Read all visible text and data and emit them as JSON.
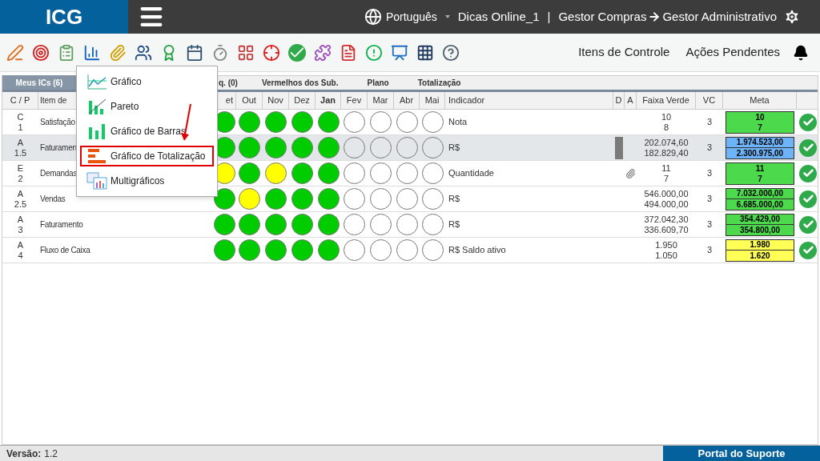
{
  "header": {
    "logo": "ICG",
    "language": "Português",
    "company": "Dicas Online_1",
    "separator": "|",
    "from_role": "Gestor Compras",
    "to_role": "Gestor Administrativo"
  },
  "toolbar": {
    "links": [
      "Itens de Controle",
      "Ações Pendentes"
    ]
  },
  "menu": {
    "items": [
      {
        "label": "Gráfico",
        "kind": "line",
        "selected": false
      },
      {
        "label": "Pareto",
        "kind": "pareto",
        "selected": false
      },
      {
        "label": "Gráfico de Barras",
        "kind": "bars",
        "selected": false
      },
      {
        "label": "Gráfico de Totalização",
        "kind": "total",
        "selected": true
      },
      {
        "label": "Multigráficos",
        "kind": "multi",
        "selected": false
      }
    ]
  },
  "tabs": [
    {
      "label": "Meus ICs (6)",
      "selected": true
    },
    {
      "label": "q. (0)",
      "selected": false
    },
    {
      "label": "Vermelhos dos Sub.",
      "selected": false
    },
    {
      "label": "Plano",
      "selected": false
    },
    {
      "label": "Totalização",
      "selected": false
    }
  ],
  "table": {
    "columns": [
      "C / P",
      "Item de",
      "et",
      "Out",
      "Nov",
      "Dez",
      "Jan",
      "Fev",
      "Mar",
      "Abr",
      "Mai",
      "Indicador",
      "D",
      "A",
      "Faixa Verde",
      "VC",
      "Meta"
    ],
    "rows": [
      {
        "cp": [
          "C",
          "1"
        ],
        "item": "Satisfação",
        "months": [
          {
            "color": "#00cc00"
          },
          {
            "color": "#00cc00"
          },
          {
            "color": "#00cc00"
          },
          {
            "color": "#00cc00"
          },
          {
            "color": "#00cc00"
          },
          {
            "color": "#ffffff"
          },
          {
            "color": "#ffffff"
          },
          {
            "color": "#ffffff"
          },
          {
            "color": "#ffffff"
          }
        ],
        "indicator": "Nota",
        "d_marker": false,
        "attachment": false,
        "faixa": [
          "10",
          "8"
        ],
        "vc": "3",
        "meta": {
          "values": [
            "10",
            "7"
          ],
          "split": false,
          "color": "#4cd94c"
        },
        "selected": false
      },
      {
        "cp": [
          "A",
          "1.5"
        ],
        "item": "Faturamen",
        "months": [
          {
            "color": "#00cc00"
          },
          {
            "color": "#00cc00"
          },
          {
            "color": "#00cc00"
          },
          {
            "color": "#00cc00"
          },
          {
            "color": "#00cc00"
          },
          {
            "color": "#e4e7ea"
          },
          {
            "color": "#e4e7ea"
          },
          {
            "color": "#e4e7ea"
          },
          {
            "color": "#e4e7ea"
          }
        ],
        "indicator": "R$",
        "d_marker": true,
        "attachment": false,
        "faixa": [
          "202.074,60",
          "182.829,40"
        ],
        "vc": "3",
        "meta": {
          "values": [
            "1.974.523,00",
            "2.300.975,00"
          ],
          "split": true,
          "color": "#6cb4f7"
        },
        "selected": true
      },
      {
        "cp": [
          "E",
          "2"
        ],
        "item": "Demandas",
        "months": [
          {
            "color": "#ffff00"
          },
          {
            "color": "#00cc00"
          },
          {
            "color": "#ffff00"
          },
          {
            "color": "#00cc00"
          },
          {
            "color": "#00cc00"
          },
          {
            "color": "#ffffff"
          },
          {
            "color": "#ffffff"
          },
          {
            "color": "#ffffff"
          },
          {
            "color": "#ffffff"
          }
        ],
        "indicator": "Quantidade",
        "d_marker": false,
        "attachment": true,
        "faixa": [
          "11",
          "7"
        ],
        "vc": "3",
        "meta": {
          "values": [
            "11",
            "7"
          ],
          "split": false,
          "color": "#4cd94c"
        },
        "selected": false
      },
      {
        "cp": [
          "A",
          "2.5"
        ],
        "item": "Vendas",
        "months": [
          {
            "color": "#00cc00"
          },
          {
            "color": "#ffff00"
          },
          {
            "color": "#00cc00"
          },
          {
            "color": "#00cc00"
          },
          {
            "color": "#00cc00"
          },
          {
            "color": "#ffffff"
          },
          {
            "color": "#ffffff"
          },
          {
            "color": "#ffffff"
          },
          {
            "color": "#ffffff"
          }
        ],
        "indicator": "R$",
        "d_marker": false,
        "attachment": false,
        "faixa": [
          "546.000,00",
          "494.000,00"
        ],
        "vc": "3",
        "meta": {
          "values": [
            "7.032.000,00",
            "6.685.000,00"
          ],
          "split": true,
          "color": "#4cd94c"
        },
        "selected": false
      },
      {
        "cp": [
          "A",
          "3"
        ],
        "item": "Faturamento",
        "months": [
          {
            "color": "#00cc00"
          },
          {
            "color": "#00cc00"
          },
          {
            "color": "#00cc00"
          },
          {
            "color": "#00cc00"
          },
          {
            "color": "#00cc00"
          },
          {
            "color": "#ffffff"
          },
          {
            "color": "#ffffff"
          },
          {
            "color": "#ffffff"
          },
          {
            "color": "#ffffff"
          }
        ],
        "indicator": "R$",
        "d_marker": false,
        "attachment": false,
        "faixa": [
          "372.042,30",
          "336.609,70"
        ],
        "vc": "3",
        "meta": {
          "values": [
            "354.429,00",
            "354.800,00"
          ],
          "split": true,
          "color": "#4cd94c"
        },
        "selected": false
      },
      {
        "cp": [
          "A",
          "4"
        ],
        "item": "Fluxo de Caixa",
        "months": [
          {
            "color": "#00cc00"
          },
          {
            "color": "#00cc00"
          },
          {
            "color": "#00cc00"
          },
          {
            "color": "#00cc00"
          },
          {
            "color": "#00cc00"
          },
          {
            "color": "#ffffff"
          },
          {
            "color": "#ffffff"
          },
          {
            "color": "#ffffff"
          },
          {
            "color": "#ffffff"
          }
        ],
        "indicator": "R$ Saldo ativo",
        "d_marker": false,
        "attachment": false,
        "faixa": [
          "1.950",
          "1.050"
        ],
        "vc": "3",
        "meta": {
          "values": [
            "1.980",
            "1.620"
          ],
          "split": true,
          "color": "#ffff55"
        },
        "selected": false
      }
    ]
  },
  "footer": {
    "version_label": "Versão:",
    "version": "1.2",
    "support": "Portal do Suporte"
  }
}
